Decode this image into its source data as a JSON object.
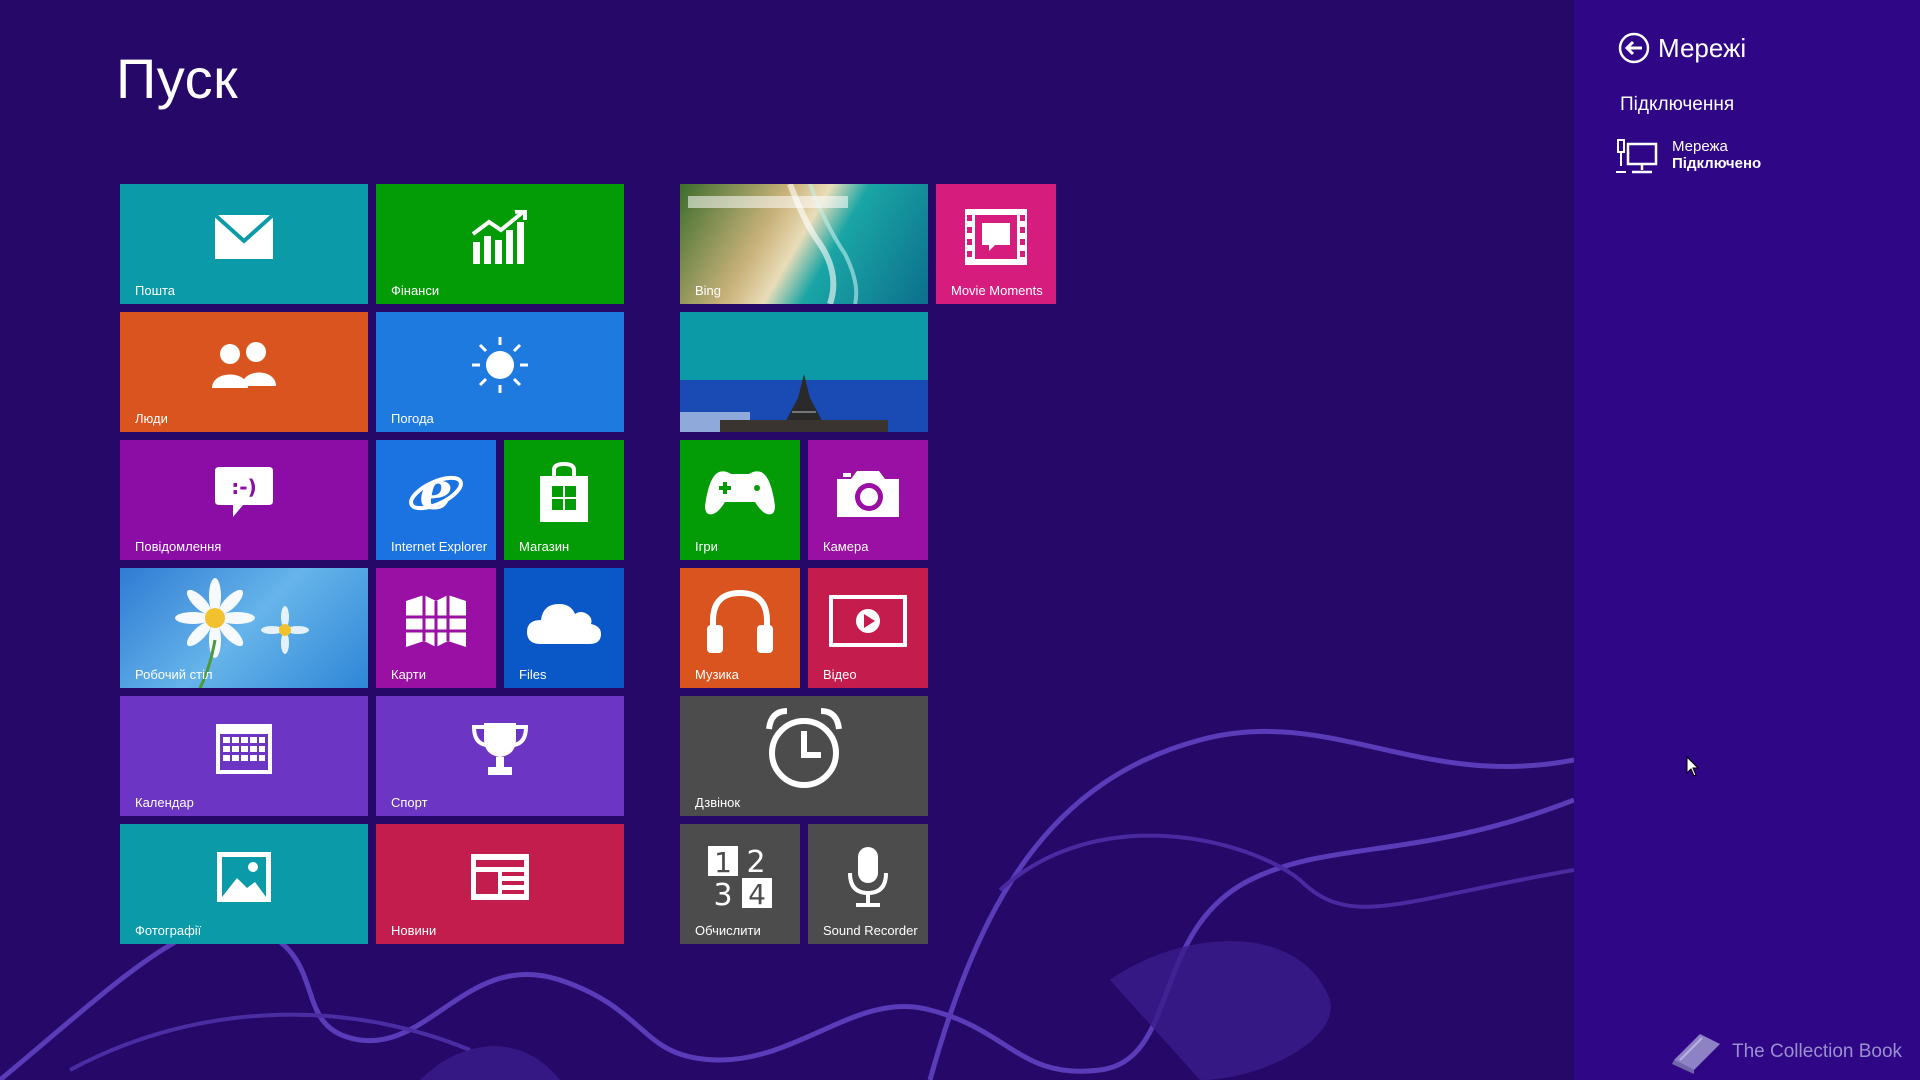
{
  "start": {
    "title": "Пуск",
    "background_color": "#250868",
    "tiles": [
      {
        "label": "Пошта",
        "icon": "mail-icon",
        "color": "#0a9aa8"
      },
      {
        "label": "Фінанси",
        "icon": "finance-chart-icon",
        "color": "#039b06"
      },
      {
        "label": "Люди",
        "icon": "people-icon",
        "color": "#d9541e"
      },
      {
        "label": "Погода",
        "icon": "sun-icon",
        "color": "#1f7ae0"
      },
      {
        "label": "Повідомлення",
        "icon": "messaging-icon",
        "color": "#8c0ca6"
      },
      {
        "label": "Internet Explorer",
        "icon": "internet-explorer-icon",
        "color": "#1a73e0"
      },
      {
        "label": "Магазин",
        "icon": "store-bag-icon",
        "color": "#039b06"
      },
      {
        "label": "Робочий стіл",
        "icon": "desktop-daisy-image",
        "color": "#4a90d6"
      },
      {
        "label": "Карти",
        "icon": "maps-icon",
        "color": "#9a0fa4"
      },
      {
        "label": "Files",
        "icon": "cloud-icon",
        "color": "#0a58c8"
      },
      {
        "label": "Календар",
        "icon": "calendar-icon",
        "color": "#6c35c4"
      },
      {
        "label": "Спорт",
        "icon": "trophy-icon",
        "color": "#6c35c4"
      },
      {
        "label": "Фотографії",
        "icon": "photos-icon",
        "color": "#0a9aa8"
      },
      {
        "label": "Новини",
        "icon": "news-icon",
        "color": "#c21d4c"
      },
      {
        "label": "Bing",
        "icon": "bing-beach-image",
        "color": "#3b8fa0"
      },
      {
        "label": "Movie Moments",
        "icon": "movie-moments-icon",
        "color": "#d61c7c"
      },
      {
        "label": "",
        "icon": "travel-eiffel-image",
        "color": "#0b9aa6"
      },
      {
        "label": "Ігри",
        "icon": "gamepad-icon",
        "color": "#039b06"
      },
      {
        "label": "Камера",
        "icon": "camera-icon",
        "color": "#9a0fa4"
      },
      {
        "label": "Музика",
        "icon": "headphones-icon",
        "color": "#d9541e"
      },
      {
        "label": "Відео",
        "icon": "video-play-icon",
        "color": "#c41c4c"
      },
      {
        "label": "Дзвінок",
        "icon": "alarm-clock-icon",
        "color": "#4c4c4c"
      },
      {
        "label": "Обчислити",
        "icon": "calculator-icon",
        "color": "#4c4c4c"
      },
      {
        "label": "Sound Recorder",
        "icon": "microphone-icon",
        "color": "#4c4c4c"
      }
    ]
  },
  "charm": {
    "background_color": "#2e0686",
    "back_icon": "back-arrow-icon",
    "title": "Мережі",
    "section": "Підключення",
    "network": {
      "icon": "wired-network-icon",
      "name": "Мережа",
      "status": "Підключено"
    }
  },
  "watermark": {
    "icon": "book-icon",
    "text": "The Collection Book"
  }
}
